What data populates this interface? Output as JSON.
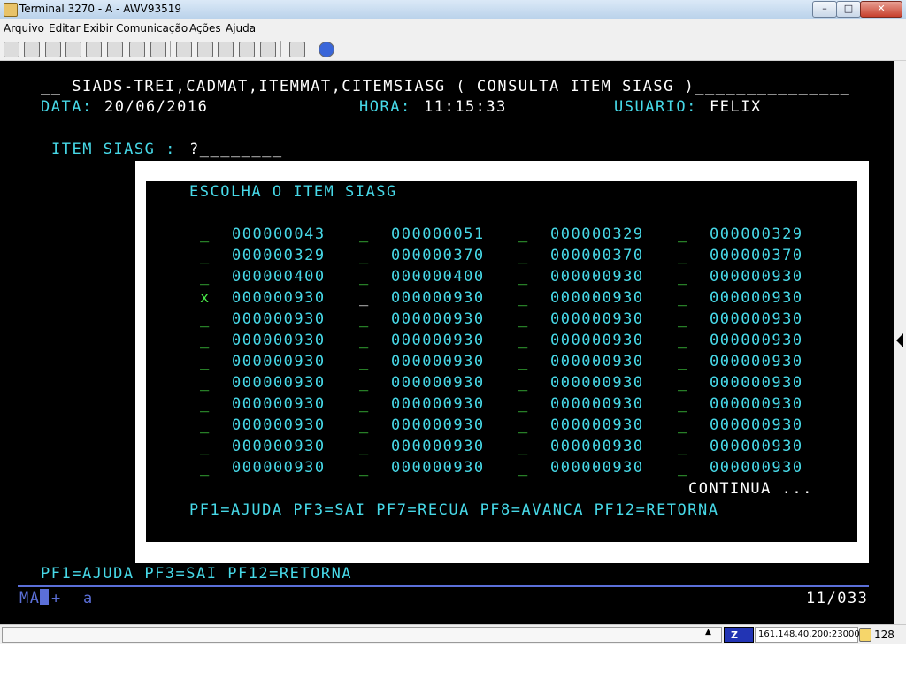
{
  "window": {
    "title": "Terminal 3270 - A - AWV93519",
    "min_label": "–",
    "max_label": "□",
    "close_label": "✕"
  },
  "menu": [
    "Arquivo",
    "Editar",
    "Exibir",
    "Comunicação",
    "Ações",
    "Ajuda"
  ],
  "toolbar_icons": [
    "print-icon",
    "print-setup-icon",
    "page-setup-icon",
    "cut-icon",
    "copy-icon",
    "paste-icon",
    "macro-icon",
    "keypad-icon",
    "transfer-icon",
    "receive-icon",
    "send-icon",
    "disconnect-icon",
    "settings-icon",
    "about-icon",
    "help-icon"
  ],
  "screen": {
    "header_line": "__ SIADS-TREI,CADMAT,ITEMMAT,CITEMSIASG ( CONSULTA ITEM SIASG )_______________",
    "data_label": "DATA:",
    "data_value": "20/06/2016",
    "hora_label": "HORA:",
    "hora_value": "11:15:33",
    "usuario_label": "USUARIO:",
    "usuario_value": "FELIX",
    "item_label": "ITEM SIASG :",
    "item_value": "?________",
    "popup": {
      "title": "ESCOLHA O ITEM SIASG",
      "rows": [
        [
          {
            "sel": "_",
            "code": "000000043"
          },
          {
            "sel": "_",
            "code": "000000051"
          },
          {
            "sel": "_",
            "code": "000000329"
          },
          {
            "sel": "_",
            "code": "000000329"
          }
        ],
        [
          {
            "sel": "_",
            "code": "000000329"
          },
          {
            "sel": "_",
            "code": "000000370"
          },
          {
            "sel": "_",
            "code": "000000370"
          },
          {
            "sel": "_",
            "code": "000000370"
          }
        ],
        [
          {
            "sel": "_",
            "code": "000000400"
          },
          {
            "sel": "_",
            "code": "000000400"
          },
          {
            "sel": "_",
            "code": "000000930"
          },
          {
            "sel": "_",
            "code": "000000930"
          }
        ],
        [
          {
            "sel": "x",
            "code": "000000930"
          },
          {
            "sel": "_",
            "code": "000000930"
          },
          {
            "sel": "_",
            "code": "000000930"
          },
          {
            "sel": "_",
            "code": "000000930"
          }
        ],
        [
          {
            "sel": "_",
            "code": "000000930"
          },
          {
            "sel": "_",
            "code": "000000930"
          },
          {
            "sel": "_",
            "code": "000000930"
          },
          {
            "sel": "_",
            "code": "000000930"
          }
        ],
        [
          {
            "sel": "_",
            "code": "000000930"
          },
          {
            "sel": "_",
            "code": "000000930"
          },
          {
            "sel": "_",
            "code": "000000930"
          },
          {
            "sel": "_",
            "code": "000000930"
          }
        ],
        [
          {
            "sel": "_",
            "code": "000000930"
          },
          {
            "sel": "_",
            "code": "000000930"
          },
          {
            "sel": "_",
            "code": "000000930"
          },
          {
            "sel": "_",
            "code": "000000930"
          }
        ],
        [
          {
            "sel": "_",
            "code": "000000930"
          },
          {
            "sel": "_",
            "code": "000000930"
          },
          {
            "sel": "_",
            "code": "000000930"
          },
          {
            "sel": "_",
            "code": "000000930"
          }
        ],
        [
          {
            "sel": "_",
            "code": "000000930"
          },
          {
            "sel": "_",
            "code": "000000930"
          },
          {
            "sel": "_",
            "code": "000000930"
          },
          {
            "sel": "_",
            "code": "000000930"
          }
        ],
        [
          {
            "sel": "_",
            "code": "000000930"
          },
          {
            "sel": "_",
            "code": "000000930"
          },
          {
            "sel": "_",
            "code": "000000930"
          },
          {
            "sel": "_",
            "code": "000000930"
          }
        ],
        [
          {
            "sel": "_",
            "code": "000000930"
          },
          {
            "sel": "_",
            "code": "000000930"
          },
          {
            "sel": "_",
            "code": "000000930"
          },
          {
            "sel": "_",
            "code": "000000930"
          }
        ],
        [
          {
            "sel": "_",
            "code": "000000930"
          },
          {
            "sel": "_",
            "code": "000000930"
          },
          {
            "sel": "_",
            "code": "000000930"
          },
          {
            "sel": "_",
            "code": "000000930"
          }
        ]
      ],
      "continua": "CONTINUA ...",
      "pf_keys": "PF1=AJUDA PF3=SAI PF7=RECUA PF8=AVANCA PF12=RETORNA"
    },
    "pf_keys": "PF1=AJUDA PF3=SAI PF12=RETORNA",
    "status_mode": "MA",
    "status_plus": "+",
    "status_a": "a",
    "cursor_pos": "11/033"
  },
  "statusbar": {
    "scroll_up": "▲",
    "host": "161.148.40.200:23000",
    "bits": "128"
  }
}
